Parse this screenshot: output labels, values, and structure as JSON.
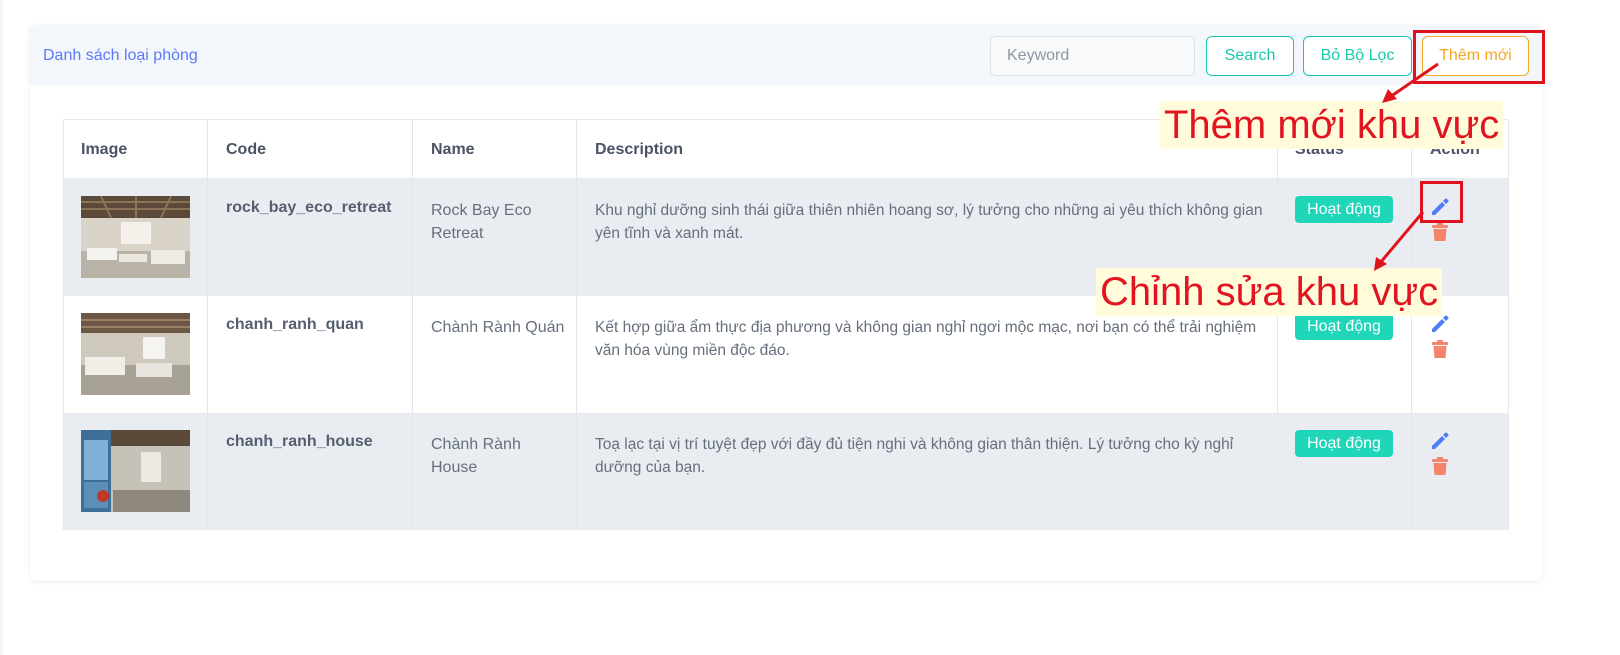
{
  "header": {
    "title": "Danh sách loại phòng",
    "keyword_placeholder": "Keyword",
    "search_label": "Search",
    "reset_label": "Bỏ Bộ Lọc",
    "add_label": "Thêm mới"
  },
  "table": {
    "columns": [
      "Image",
      "Code",
      "Name",
      "Description",
      "Status",
      "Action"
    ],
    "rows": [
      {
        "code": "rock_bay_eco_retreat",
        "name": "Rock Bay Eco Retreat",
        "description": "Khu nghỉ dưỡng sinh thái giữa thiên nhiên hoang sơ, lý tưởng cho những ai yêu thích không gian yên tĩnh và xanh mát.",
        "status": "Hoạt động"
      },
      {
        "code": "chanh_ranh_quan",
        "name": "Chành Rành Quán",
        "description": "Kết hợp giữa ẩm thực địa phương và không gian nghỉ ngơi mộc mạc, nơi bạn có thể trải nghiệm văn hóa vùng miền độc đáo.",
        "status": "Hoạt động"
      },
      {
        "code": "chanh_ranh_house",
        "name": "Chành Rành House",
        "description": "Toạ lạc tại vị trí tuyệt đẹp với đầy đủ tiện nghi và không gian thân thiện. Lý tưởng cho kỳ nghỉ dưỡng của bạn.",
        "status": "Hoạt động"
      }
    ]
  },
  "annotations": {
    "add_note": "Thêm mới khu vực",
    "edit_note": "Chỉnh sửa khu vực"
  },
  "icons": {
    "edit": "pencil-icon",
    "delete": "trash-icon"
  },
  "colors": {
    "accent_teal": "#17c9ae",
    "accent_orange": "#f6a623",
    "title_blue": "#5b7cf6",
    "status_badge": "#1fd6b8",
    "edit_icon": "#4f7df3",
    "delete_icon": "#f4846b",
    "annotation_red": "#e0121b"
  }
}
